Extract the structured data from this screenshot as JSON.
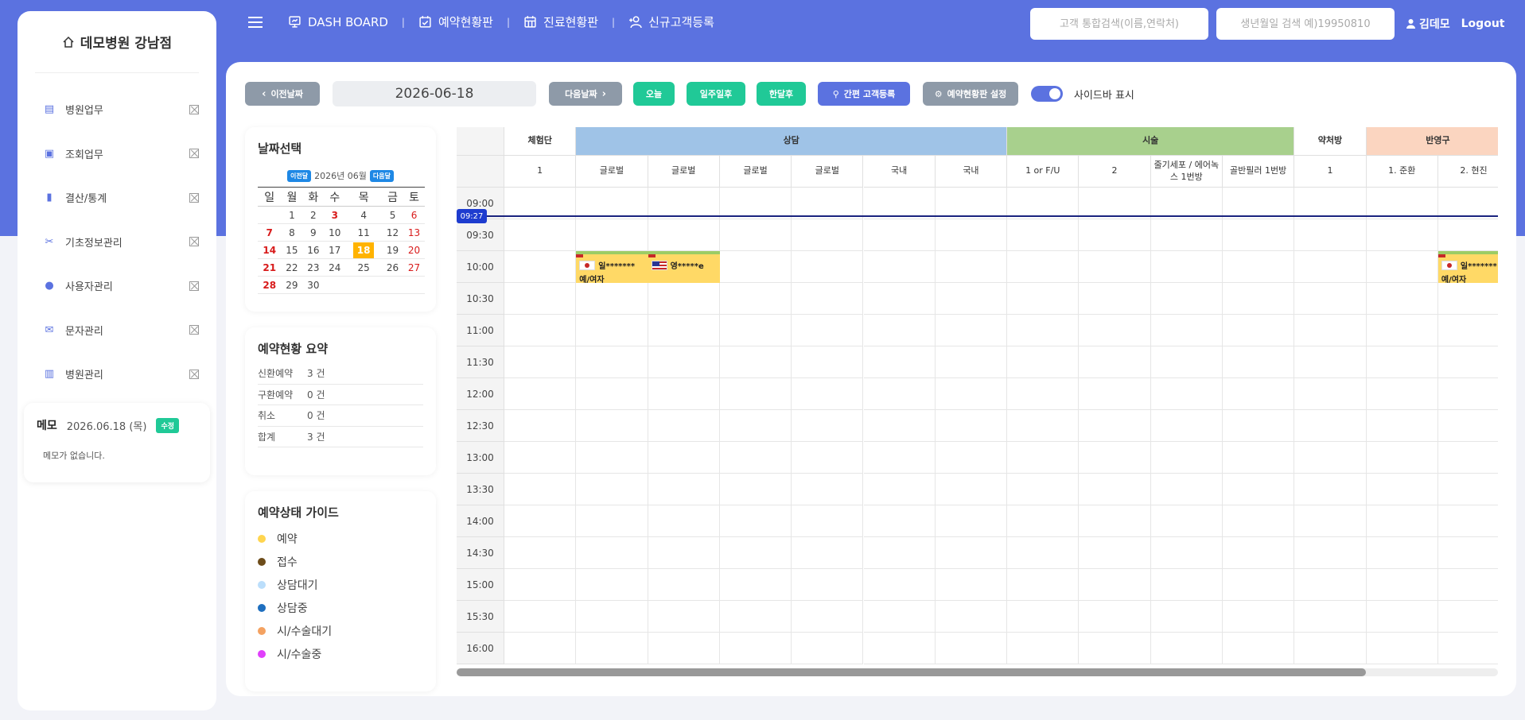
{
  "sidebar": {
    "title": "데모병원 강남점",
    "items": [
      {
        "label": "병원업무",
        "icon": "document-icon"
      },
      {
        "label": "조회업무",
        "icon": "id-card-icon"
      },
      {
        "label": "결산/통계",
        "icon": "bar-chart-icon"
      },
      {
        "label": "기초정보관리",
        "icon": "tools-icon"
      },
      {
        "label": "사용자관리",
        "icon": "user-circle-icon"
      },
      {
        "label": "문자관리",
        "icon": "envelope-icon"
      },
      {
        "label": "병원관리",
        "icon": "building-icon"
      }
    ],
    "memo": {
      "title": "메모",
      "date": "2026.06.18 (목)",
      "badge": "수정",
      "body": "메모가 없습니다."
    }
  },
  "nav": {
    "items": [
      {
        "label": "DASH BOARD",
        "icon": "dashboard-icon"
      },
      {
        "label": "예약현황판",
        "icon": "calendar-check-icon"
      },
      {
        "label": "진료현황판",
        "icon": "calendar-grid-icon"
      },
      {
        "label": "신규고객등록",
        "icon": "user-add-icon"
      }
    ],
    "search_customer_placeholder": "고객 통합검색(이름,연락처)",
    "search_birth_placeholder": "생년월일 검색 예)19950810",
    "user_name": "김데모",
    "logout": "Logout"
  },
  "toolbar": {
    "prev": "이전날짜",
    "date": "2026-06-18",
    "next": "다음날짜",
    "today": "오늘",
    "week_after": "일주일후",
    "month_after": "한달후",
    "quick_register": "간편 고객등록",
    "settings": "예약현황판 설정",
    "sidebar_toggle": "사이드바 표시"
  },
  "calendar": {
    "title": "날짜선택",
    "prev": "이전달",
    "month": "2026년 06월",
    "next": "다음달",
    "weekdays": [
      "일",
      "월",
      "화",
      "수",
      "목",
      "금",
      "토"
    ],
    "weeks": [
      [
        "",
        "1",
        "2",
        "3",
        "4",
        "5",
        "6"
      ],
      [
        "7",
        "8",
        "9",
        "10",
        "11",
        "12",
        "13"
      ],
      [
        "14",
        "15",
        "16",
        "17",
        "18",
        "19",
        "20"
      ],
      [
        "21",
        "22",
        "23",
        "24",
        "25",
        "26",
        "27"
      ],
      [
        "28",
        "29",
        "30",
        "",
        "",
        "",
        ""
      ]
    ],
    "today": "18"
  },
  "summary": {
    "title": "예약현황 요약",
    "rows": [
      {
        "label": "신환예약",
        "value": "3 건"
      },
      {
        "label": "구환예약",
        "value": "0 건"
      },
      {
        "label": "취소",
        "value": "0 건"
      },
      {
        "label": "합계",
        "value": "3 건"
      }
    ]
  },
  "guide": {
    "title": "예약상태 가이드",
    "items": [
      {
        "label": "예약",
        "color": "#ffd54f"
      },
      {
        "label": "접수",
        "color": "#6d4c1a"
      },
      {
        "label": "상담대기",
        "color": "#bbdefb"
      },
      {
        "label": "상담중",
        "color": "#1e6fbf"
      },
      {
        "label": "시/수술대기",
        "color": "#f4a261"
      },
      {
        "label": "시/수술중",
        "color": "#e040fb"
      }
    ]
  },
  "schedule": {
    "groups": [
      {
        "label": "체험단",
        "span": 1,
        "color": "#ffffff"
      },
      {
        "label": "상담",
        "span": 6,
        "color": "#9fc3e7"
      },
      {
        "label": "시술",
        "span": 4,
        "color": "#a8d08d"
      },
      {
        "label": "약처방",
        "span": 1,
        "color": "#ffffff"
      },
      {
        "label": "반영구",
        "span": 2,
        "color": "#fbd5c0"
      }
    ],
    "columns": [
      "1",
      "글로벌",
      "글로벌",
      "글로벌",
      "글로벌",
      "국내",
      "국내",
      "1 or F/U",
      "2",
      "줄기세포 / 에어녹스 1번방",
      "골반필러 1번방",
      "1",
      "1. 준환",
      "2. 현진"
    ],
    "times": [
      "09:00",
      "09:30",
      "10:00",
      "10:30",
      "11:00",
      "11:30",
      "12:00",
      "12:30",
      "13:00",
      "13:30",
      "14:00",
      "14:30",
      "15:00",
      "15:30",
      "16:00"
    ],
    "now": "09:27",
    "appointments": [
      {
        "col": 1,
        "slot": 2,
        "flag": "jp",
        "name": "일*******",
        "sub": "예/여자"
      },
      {
        "col": 2,
        "slot": 2,
        "flag": "us",
        "name": "영*****e",
        "sub": ""
      },
      {
        "col": 13,
        "slot": 2,
        "flag": "jp",
        "name": "일*******",
        "sub": "예/여자"
      }
    ],
    "scroll_position": 0.873
  }
}
